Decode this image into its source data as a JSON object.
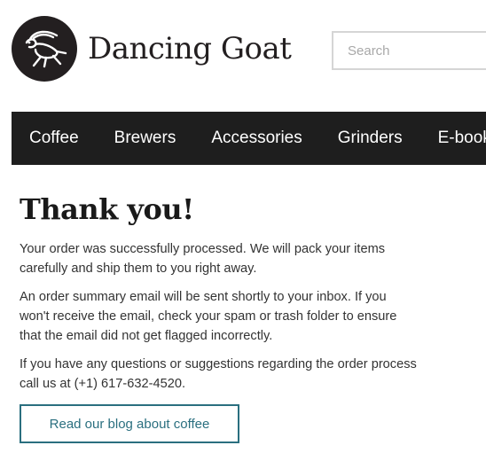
{
  "header": {
    "logo_text": "Dancing Goat",
    "logo_icon": "dancing-goat-logo-icon",
    "search_placeholder": "Search"
  },
  "nav": {
    "items": [
      {
        "label": "Coffee"
      },
      {
        "label": "Brewers"
      },
      {
        "label": "Accessories"
      },
      {
        "label": "Grinders"
      },
      {
        "label": "E-books"
      }
    ]
  },
  "main": {
    "title": "Thank you!",
    "paragraphs": [
      "Your order was successfully processed. We will pack your items carefully and ship them to you right away.",
      "An order summary email will be sent shortly to your inbox. If you won't receive the email, check your spam or trash folder to ensure that the email did not get flagged incorrectly.",
      "If you have any questions or suggestions regarding the order process call us at (+1) 617-632-4520."
    ],
    "blog_button_label": "Read our blog about coffee"
  },
  "colors": {
    "nav_background": "#1e1e1e",
    "accent": "#2a6f7f",
    "logo_dark": "#231f20"
  }
}
